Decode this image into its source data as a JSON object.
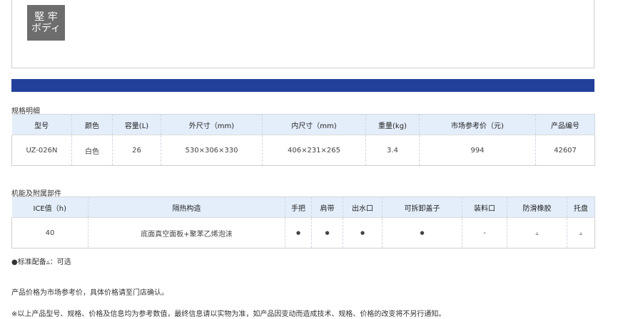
{
  "badge": {
    "line1": "堅 牢",
    "line2": "ボディ"
  },
  "spec": {
    "title": "规格明细",
    "headers": [
      "型号",
      "颜色",
      "容量(L)",
      "外尺寸（mm)",
      "内尺寸（mm)",
      "重量(kg)",
      "市场参考价（元)",
      "产品编号"
    ],
    "row": [
      "UZ-026N",
      "白色",
      "26",
      "530×306×330",
      "406×231×265",
      "3.4",
      "994",
      "42607"
    ]
  },
  "func": {
    "title": "机能及附属部件",
    "headers": [
      "ICE值（h)",
      "隔热构造",
      "手把",
      "肩带",
      "出水口",
      "可拆卸盖子",
      "装料口",
      "防滑橡胶",
      "托盘"
    ],
    "row": [
      "40",
      "底面真空面板+聚苯乙烯泡沫",
      "●",
      "●",
      "●",
      "●",
      "-",
      "▵",
      "▵"
    ]
  },
  "notes": {
    "legend": "●标准配备▵：可选",
    "price": "产品价格为市场参考价，具体价格请至门店确认。",
    "disclaimer": "※以上产品型号、规格、价格及信息均为参考数值，最终信息请以实物为准，如产品因变动而造成技术、规格、价格的改变将不另行通知。"
  }
}
